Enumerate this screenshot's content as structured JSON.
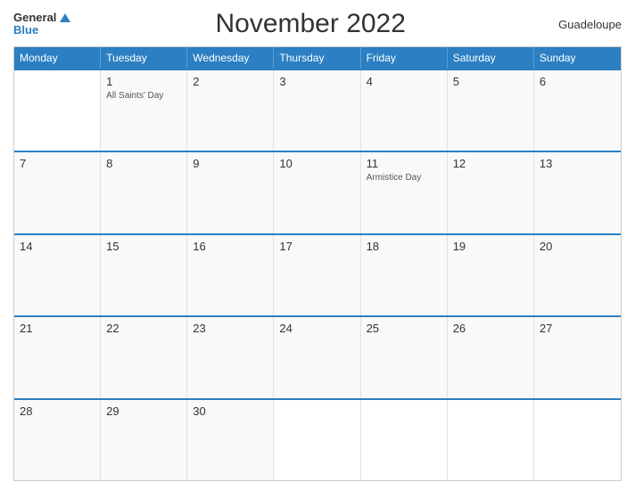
{
  "header": {
    "logo_general": "General",
    "logo_blue": "Blue",
    "title": "November 2022",
    "country": "Guadeloupe"
  },
  "days": [
    "Monday",
    "Tuesday",
    "Wednesday",
    "Thursday",
    "Friday",
    "Saturday",
    "Sunday"
  ],
  "weeks": [
    [
      {
        "num": "",
        "event": "",
        "empty": true
      },
      {
        "num": "1",
        "event": "All Saints' Day",
        "empty": false
      },
      {
        "num": "2",
        "event": "",
        "empty": false
      },
      {
        "num": "3",
        "event": "",
        "empty": false
      },
      {
        "num": "4",
        "event": "",
        "empty": false
      },
      {
        "num": "5",
        "event": "",
        "empty": false
      },
      {
        "num": "6",
        "event": "",
        "empty": false
      }
    ],
    [
      {
        "num": "7",
        "event": "",
        "empty": false
      },
      {
        "num": "8",
        "event": "",
        "empty": false
      },
      {
        "num": "9",
        "event": "",
        "empty": false
      },
      {
        "num": "10",
        "event": "",
        "empty": false
      },
      {
        "num": "11",
        "event": "Armistice Day",
        "empty": false
      },
      {
        "num": "12",
        "event": "",
        "empty": false
      },
      {
        "num": "13",
        "event": "",
        "empty": false
      }
    ],
    [
      {
        "num": "14",
        "event": "",
        "empty": false
      },
      {
        "num": "15",
        "event": "",
        "empty": false
      },
      {
        "num": "16",
        "event": "",
        "empty": false
      },
      {
        "num": "17",
        "event": "",
        "empty": false
      },
      {
        "num": "18",
        "event": "",
        "empty": false
      },
      {
        "num": "19",
        "event": "",
        "empty": false
      },
      {
        "num": "20",
        "event": "",
        "empty": false
      }
    ],
    [
      {
        "num": "21",
        "event": "",
        "empty": false
      },
      {
        "num": "22",
        "event": "",
        "empty": false
      },
      {
        "num": "23",
        "event": "",
        "empty": false
      },
      {
        "num": "24",
        "event": "",
        "empty": false
      },
      {
        "num": "25",
        "event": "",
        "empty": false
      },
      {
        "num": "26",
        "event": "",
        "empty": false
      },
      {
        "num": "27",
        "event": "",
        "empty": false
      }
    ],
    [
      {
        "num": "28",
        "event": "",
        "empty": false
      },
      {
        "num": "29",
        "event": "",
        "empty": false
      },
      {
        "num": "30",
        "event": "",
        "empty": false
      },
      {
        "num": "",
        "event": "",
        "empty": true
      },
      {
        "num": "",
        "event": "",
        "empty": true
      },
      {
        "num": "",
        "event": "",
        "empty": true
      },
      {
        "num": "",
        "event": "",
        "empty": true
      }
    ]
  ]
}
